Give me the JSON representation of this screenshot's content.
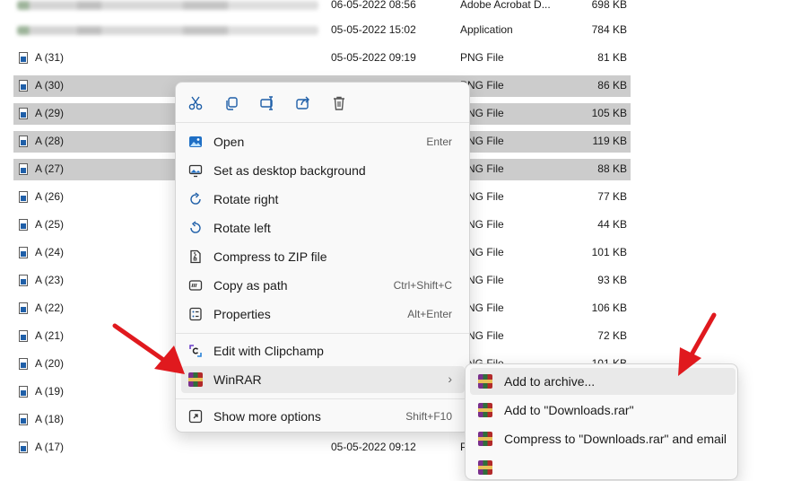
{
  "file_list": {
    "rows": [
      {
        "name": "",
        "date": "06-05-2022 08:56",
        "type": "Adobe Acrobat D...",
        "size": "698 KB",
        "selected": false,
        "blurred": true
      },
      {
        "name": "",
        "date": "05-05-2022 15:02",
        "type": "Application",
        "size": "784 KB",
        "selected": false,
        "blurred": true
      },
      {
        "name": "A (31)",
        "date": "05-05-2022 09:19",
        "type": "PNG File",
        "size": "81 KB",
        "selected": false
      },
      {
        "name": "A (30)",
        "date": "",
        "type": "PNG File",
        "size": "86 KB",
        "selected": true
      },
      {
        "name": "A (29)",
        "date": "",
        "type": "PNG File",
        "size": "105 KB",
        "selected": true
      },
      {
        "name": "A (28)",
        "date": "",
        "type": "PNG File",
        "size": "119 KB",
        "selected": true
      },
      {
        "name": "A (27)",
        "date": "",
        "type": "PNG File",
        "size": "88 KB",
        "selected": true
      },
      {
        "name": "A (26)",
        "date": "",
        "type": "PNG File",
        "size": "77 KB",
        "selected": false
      },
      {
        "name": "A (25)",
        "date": "",
        "type": "PNG File",
        "size": "44 KB",
        "selected": false
      },
      {
        "name": "A (24)",
        "date": "",
        "type": "PNG File",
        "size": "101 KB",
        "selected": false
      },
      {
        "name": "A (23)",
        "date": "",
        "type": "PNG File",
        "size": "93 KB",
        "selected": false
      },
      {
        "name": "A (22)",
        "date": "",
        "type": "PNG File",
        "size": "106 KB",
        "selected": false
      },
      {
        "name": "A (21)",
        "date": "",
        "type": "PNG File",
        "size": "72 KB",
        "selected": false
      },
      {
        "name": "A (20)",
        "date": "",
        "type": "PNG File",
        "size": "101 KB",
        "selected": false
      },
      {
        "name": "A (19)",
        "date": "",
        "type": "",
        "size": "",
        "selected": false
      },
      {
        "name": "A (18)",
        "date": "",
        "type": "",
        "size": "",
        "selected": false
      },
      {
        "name": "A (17)",
        "date": "05-05-2022 09:12",
        "type": "PNG File",
        "size": "",
        "selected": false
      }
    ]
  },
  "context_menu": {
    "quick_actions": [
      {
        "name": "cut",
        "icon": "scissors-icon"
      },
      {
        "name": "copy",
        "icon": "copy-icon"
      },
      {
        "name": "rename",
        "icon": "rename-icon"
      },
      {
        "name": "share",
        "icon": "share-icon"
      },
      {
        "name": "delete",
        "icon": "trash-icon"
      }
    ],
    "items": [
      {
        "label": "Open",
        "shortcut": "Enter",
        "icon": "image-open-icon"
      },
      {
        "label": "Set as desktop background",
        "shortcut": "",
        "icon": "desktop-background-icon"
      },
      {
        "label": "Rotate right",
        "shortcut": "",
        "icon": "rotate-right-icon"
      },
      {
        "label": "Rotate left",
        "shortcut": "",
        "icon": "rotate-left-icon"
      },
      {
        "label": "Compress to ZIP file",
        "shortcut": "",
        "icon": "zip-icon"
      },
      {
        "label": "Copy as path",
        "shortcut": "Ctrl+Shift+C",
        "icon": "copy-path-icon"
      },
      {
        "label": "Properties",
        "shortcut": "Alt+Enter",
        "icon": "properties-icon"
      },
      {
        "label": "Edit with Clipchamp",
        "shortcut": "",
        "icon": "clipchamp-icon"
      },
      {
        "label": "WinRAR",
        "shortcut": "",
        "icon": "winrar-icon",
        "submenu": true
      },
      {
        "label": "Show more options",
        "shortcut": "Shift+F10",
        "icon": "more-options-icon"
      }
    ]
  },
  "winrar_submenu": {
    "items": [
      {
        "label": "Add to archive...",
        "icon": "winrar-icon"
      },
      {
        "label": "Add to \"Downloads.rar\"",
        "icon": "winrar-icon"
      },
      {
        "label": "Compress to \"Downloads.rar\" and email",
        "icon": "winrar-icon"
      },
      {
        "label": "",
        "icon": "winrar-icon"
      }
    ]
  },
  "colors": {
    "selection": "#cccccc",
    "menu_background": "#f9f9f9",
    "hover": "#e9e9e9",
    "annotation_arrow": "#e0191e"
  }
}
